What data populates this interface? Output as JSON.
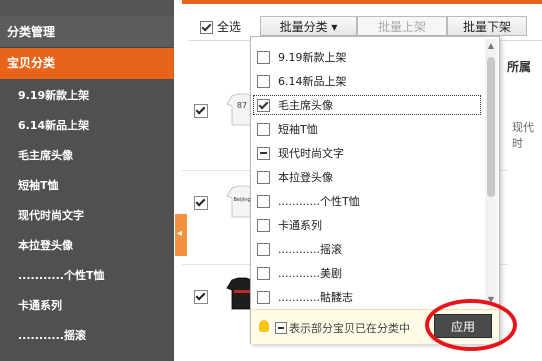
{
  "sidebar": {
    "header": "分类管理",
    "active": "宝贝分类",
    "items": [
      "9.19新款上架",
      "6.14新品上架",
      "毛主席头像",
      "短袖T恤",
      "现代时尚文字",
      "本拉登头像",
      "...........个性T恤",
      "卡通系列",
      "...........摇滚"
    ]
  },
  "toolbar": {
    "select_all": "全选",
    "batch_category": "批量分类",
    "batch_list": "批量上架",
    "batch_delist": "批量下架"
  },
  "table": {
    "column_category": "所属",
    "row_desc": "现代时"
  },
  "thumbs": [
    "87",
    "Beijing",
    ""
  ],
  "dropdown": {
    "options": [
      {
        "label": "9.19新款上架",
        "state": "unchecked"
      },
      {
        "label": "6.14新品上架",
        "state": "unchecked"
      },
      {
        "label": "毛主席头像",
        "state": "checked"
      },
      {
        "label": "短袖T恤",
        "state": "unchecked"
      },
      {
        "label": "现代时尚文字",
        "state": "partial"
      },
      {
        "label": "本拉登头像",
        "state": "unchecked"
      },
      {
        "label": "............个性T恤",
        "state": "unchecked"
      },
      {
        "label": "卡通系列",
        "state": "unchecked"
      },
      {
        "label": "............摇滚",
        "state": "unchecked"
      },
      {
        "label": "............美剧",
        "state": "unchecked"
      },
      {
        "label": "............骷髅志",
        "state": "unchecked"
      }
    ],
    "footer_hint": "表示部分宝贝已在分类中",
    "apply": "应用"
  },
  "colors": {
    "accent": "#e8641b",
    "sidebar_bg": "#505050",
    "highlight": "#e8141c"
  }
}
